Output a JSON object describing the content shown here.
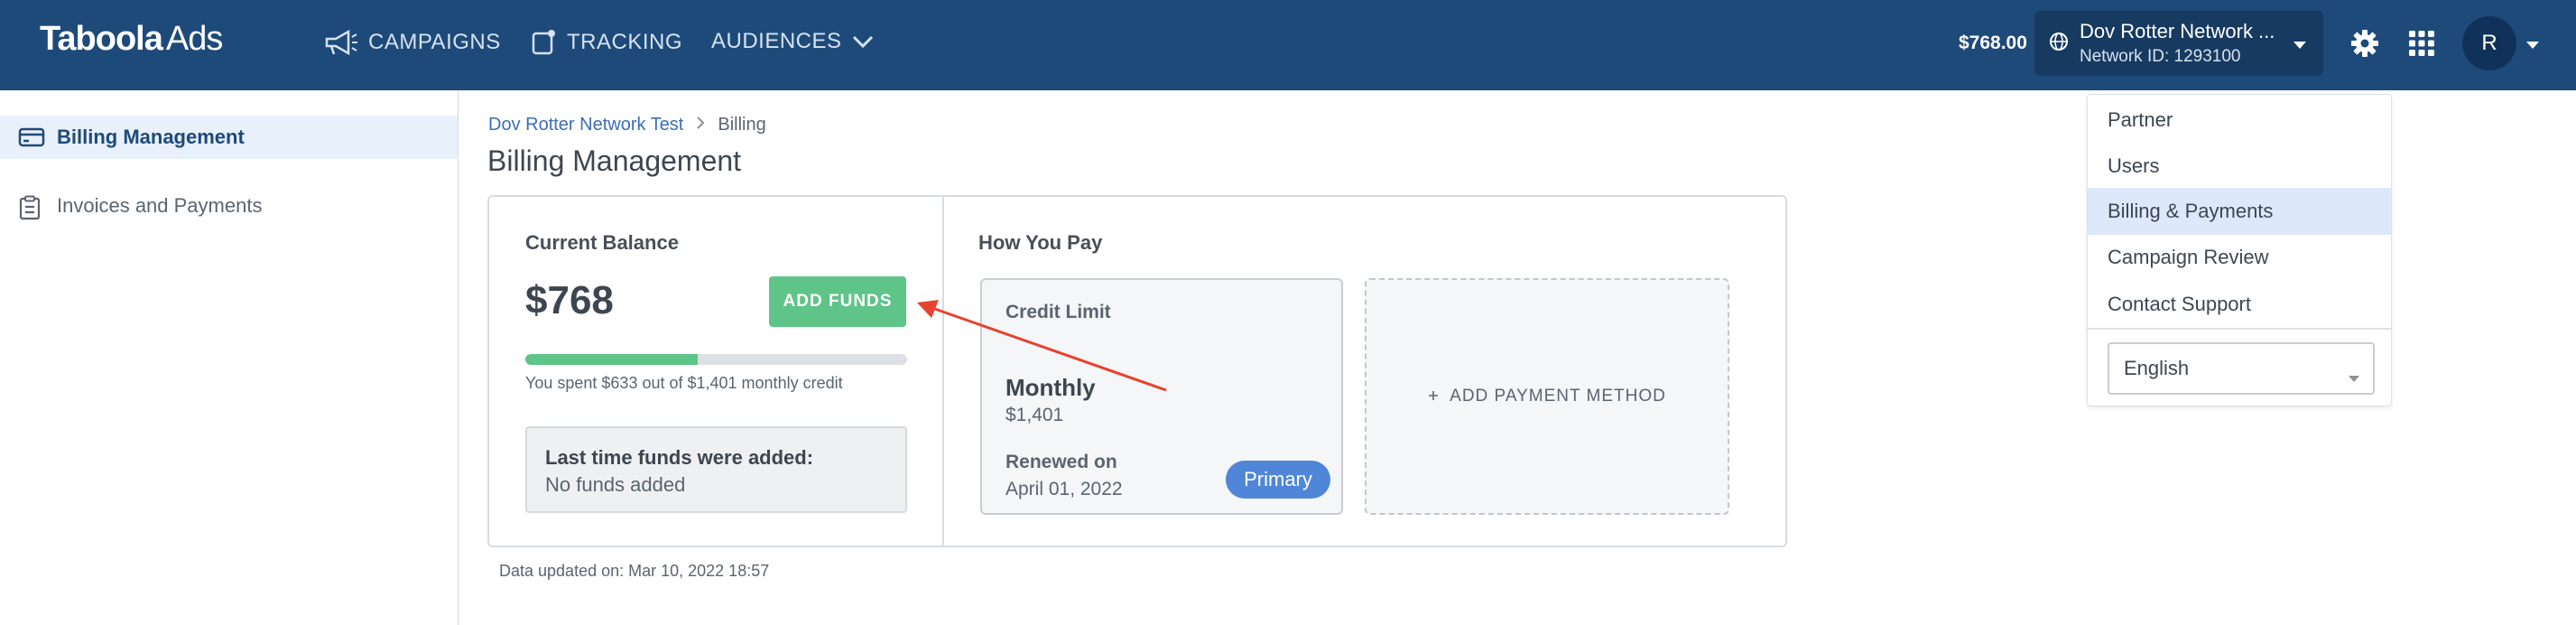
{
  "header": {
    "logo_main": "Taboola",
    "logo_sub": "Ads",
    "nav": [
      {
        "label": "CAMPAIGNS",
        "icon": "megaphone-icon"
      },
      {
        "label": "TRACKING",
        "icon": "tracking-icon"
      },
      {
        "label": "AUDIENCES",
        "icon": "chevron-down-icon"
      }
    ],
    "balance": "$768.00",
    "network_name": "Dov Rotter Network ...",
    "network_id": "Network ID: 1293100",
    "avatar_initial": "R",
    "colors": {
      "bar": "#1e4a7a",
      "network_box": "#173a61"
    }
  },
  "sidebar": {
    "items": [
      {
        "label": "Billing Management",
        "icon": "credit-card-icon",
        "active": true
      },
      {
        "label": "Invoices and Payments",
        "icon": "clipboard-icon",
        "active": false
      }
    ]
  },
  "breadcrumb": {
    "parent": "Dov Rotter Network Test",
    "current": "Billing"
  },
  "page_title": "Billing Management",
  "current_balance": {
    "title": "Current Balance",
    "amount": "$768",
    "add_funds_label": "ADD FUNDS",
    "spent_fraction": 0.452,
    "spent_text": "You spent $633 out of $1,401 monthly credit",
    "last_funds_title": "Last time funds were added:",
    "last_funds_value": "No funds added"
  },
  "how_you_pay": {
    "title": "How You Pay",
    "credit_label": "Credit Limit",
    "monthly_label": "Monthly",
    "monthly_value": "$1,401",
    "renewed_label": "Renewed on",
    "renewed_value": "April 01, 2022",
    "badge": "Primary",
    "add_payment_label": "ADD PAYMENT METHOD"
  },
  "data_updated": "Data updated on: Mar 10, 2022 18:57",
  "user_menu": {
    "items": [
      "Partner",
      "Users",
      "Billing & Payments",
      "Campaign Review",
      "Contact Support"
    ],
    "selected": "Billing & Payments",
    "language": "English"
  },
  "accent_colors": {
    "green": "#5fc488",
    "blue": "#4f86d8",
    "annotation_arrow": "#e8412e"
  }
}
